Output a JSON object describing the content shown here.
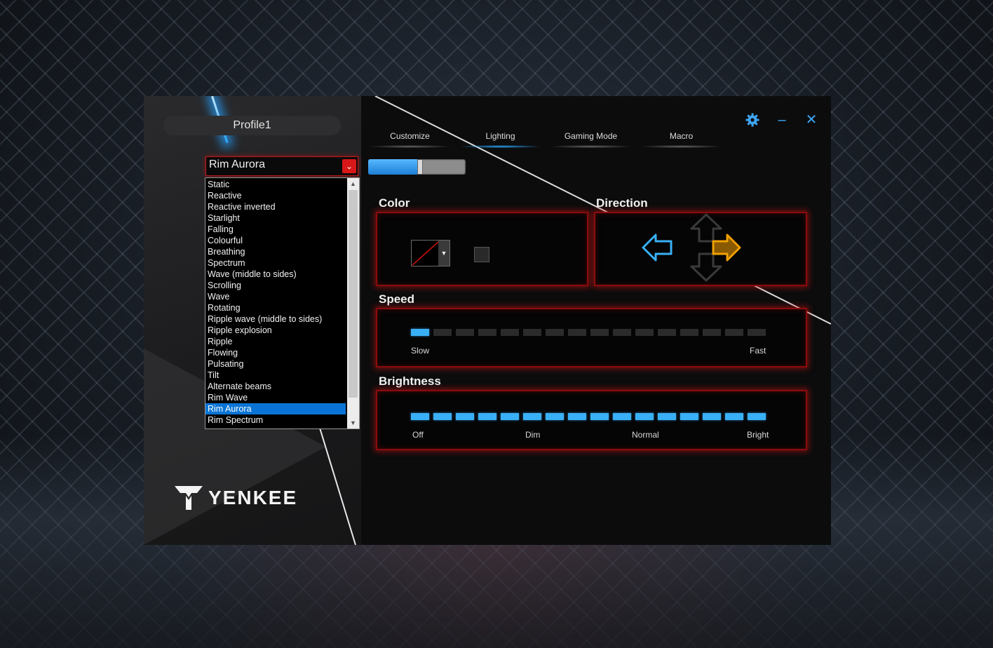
{
  "profile": {
    "name": "Profile1"
  },
  "tabs": [
    {
      "label": "Customize",
      "active": false
    },
    {
      "label": "Lighting",
      "active": true
    },
    {
      "label": "Gaming Mode",
      "active": false
    },
    {
      "label": "Macro",
      "active": false
    }
  ],
  "window_controls": {
    "settings_icon": "gear-icon",
    "minimize_icon": "minimize-icon",
    "close_icon": "close-icon",
    "minimize_glyph": "–",
    "close_glyph": "✕"
  },
  "mode_select": {
    "value": "Rim Aurora",
    "arrow_glyph": "⌄"
  },
  "mode_options": [
    "Static",
    "Reactive",
    "Reactive inverted",
    "Starlight",
    "Falling",
    "Colourful",
    "Breathing",
    "Spectrum",
    "Wave (middle to sides)",
    "Scrolling",
    "Wave",
    "Rotating",
    "Ripple wave (middle to sides)",
    "Ripple explosion",
    "Ripple",
    "Flowing",
    "Pulsating",
    "Tilt",
    "Alternate beams",
    "Rim Wave",
    "Rim Aurora",
    "Rim Spectrum"
  ],
  "selected_option_index": 20,
  "scrollbar": {
    "up_glyph": "▲",
    "down_glyph": "▼"
  },
  "lighting_toggle": {
    "level": 0.5
  },
  "color_section": {
    "label": "Color",
    "dropdown_glyph": "▼"
  },
  "direction_section": {
    "label": "Direction",
    "active": "right"
  },
  "speed_section": {
    "label": "Speed",
    "segments": 16,
    "level": 1,
    "ticks": [
      "Slow",
      "Fast"
    ]
  },
  "brightness_section": {
    "label": "Brightness",
    "segments": 16,
    "level": 16,
    "ticks": [
      "Off",
      "Dim",
      "Normal",
      "Bright"
    ]
  },
  "logo": {
    "text": "YENKEE"
  },
  "colors": {
    "accent": "#39b0f5",
    "frame_red": "#8a0c0c",
    "selection": "#0a74d6",
    "direction_active": "#f0a000"
  }
}
